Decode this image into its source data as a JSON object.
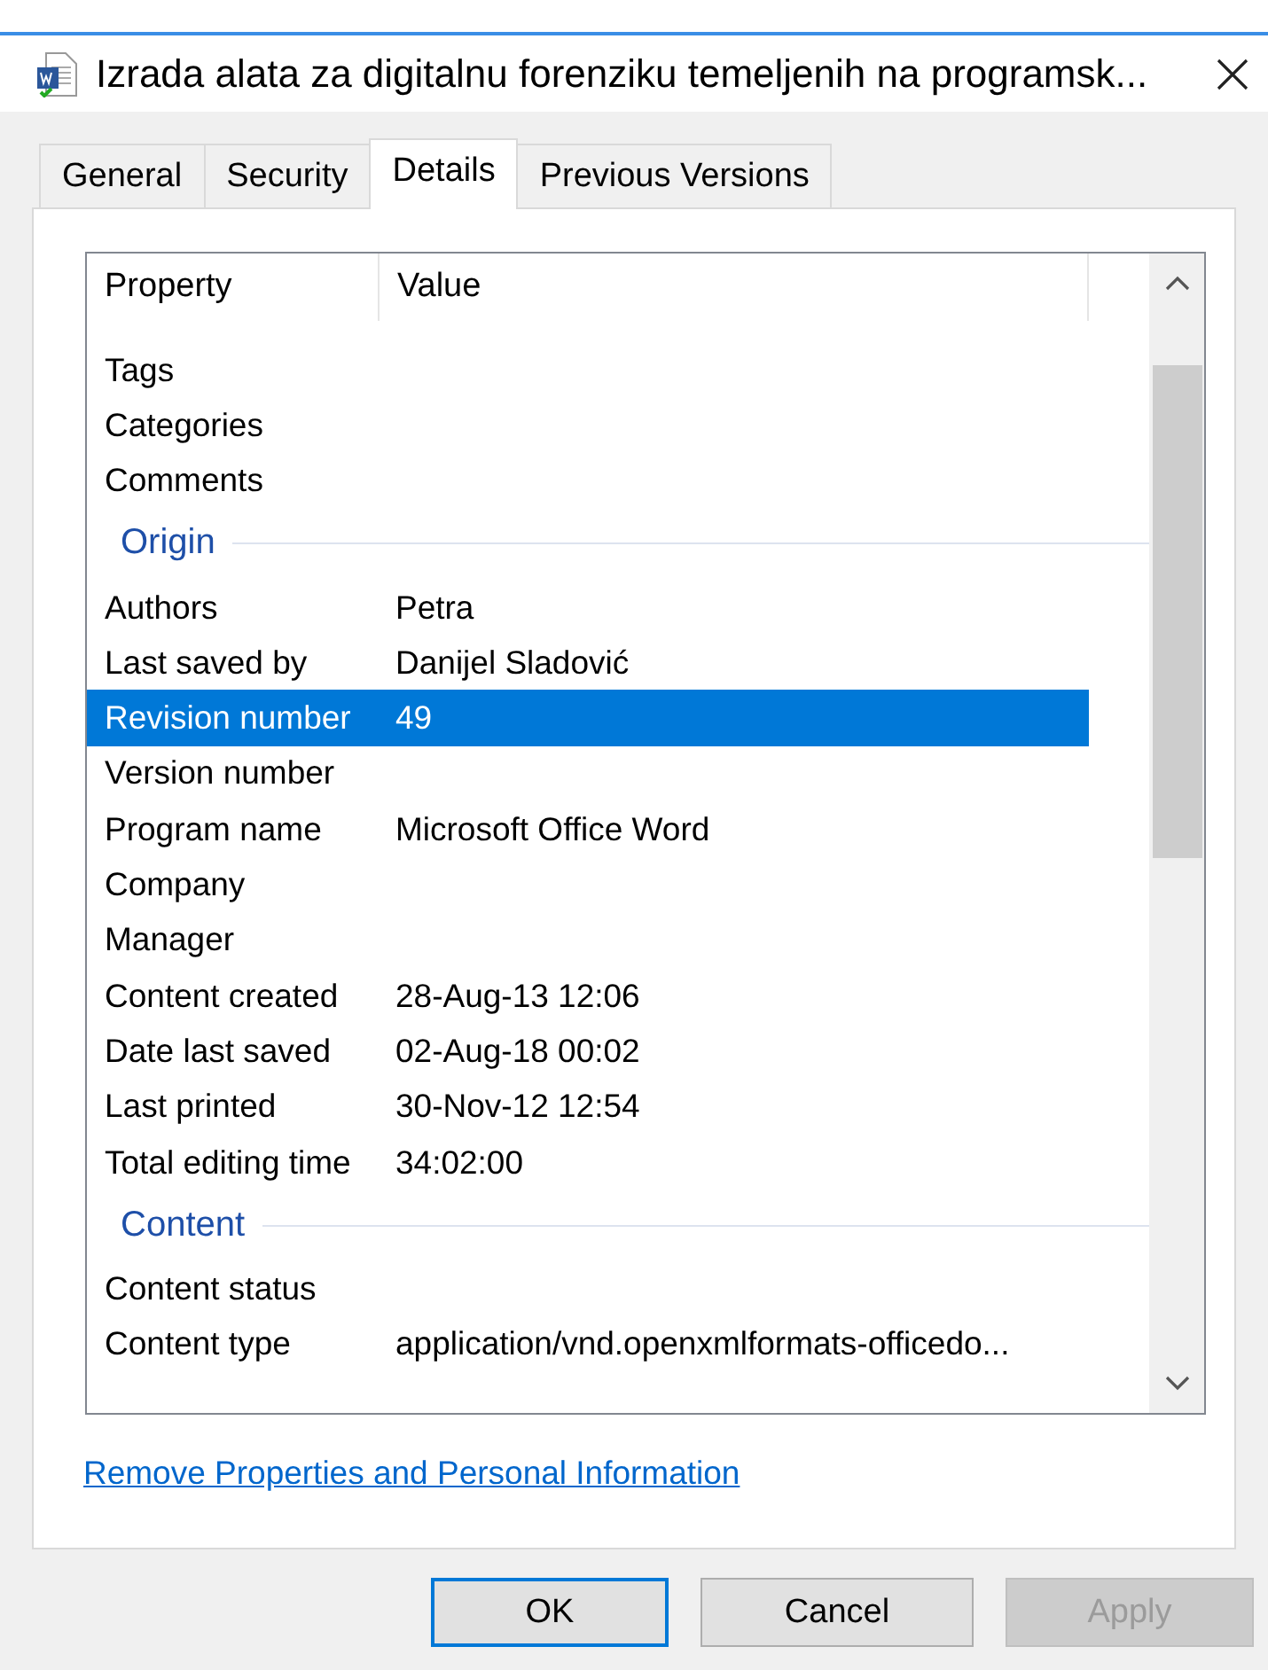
{
  "window": {
    "title": "Izrada alata za digitalnu forenziku temeljenih na programsk..."
  },
  "tabs": [
    {
      "label": "General",
      "selected": false
    },
    {
      "label": "Security",
      "selected": false
    },
    {
      "label": "Details",
      "selected": true
    },
    {
      "label": "Previous Versions",
      "selected": false
    }
  ],
  "table": {
    "columns": [
      "Property",
      "Value"
    ],
    "rows": [
      {
        "kind": "property",
        "property": "Tags",
        "value": "",
        "selected": false
      },
      {
        "kind": "property",
        "property": "Categories",
        "value": "",
        "selected": false
      },
      {
        "kind": "property",
        "property": "Comments",
        "value": "",
        "selected": false
      },
      {
        "kind": "group",
        "property": "Origin"
      },
      {
        "kind": "property",
        "property": "Authors",
        "value": "Petra",
        "selected": false
      },
      {
        "kind": "property",
        "property": "Last saved by",
        "value": "Danijel Sladović",
        "selected": false
      },
      {
        "kind": "property",
        "property": "Revision number",
        "value": "49",
        "selected": true
      },
      {
        "kind": "property",
        "property": "Version number",
        "value": "",
        "selected": false
      },
      {
        "kind": "property",
        "property": "Program name",
        "value": "Microsoft Office Word",
        "selected": false
      },
      {
        "kind": "property",
        "property": "Company",
        "value": "",
        "selected": false
      },
      {
        "kind": "property",
        "property": "Manager",
        "value": "",
        "selected": false
      },
      {
        "kind": "property",
        "property": "Content created",
        "value": "28-Aug-13 12:06",
        "selected": false
      },
      {
        "kind": "property",
        "property": "Date last saved",
        "value": "02-Aug-18 00:02",
        "selected": false
      },
      {
        "kind": "property",
        "property": "Last printed",
        "value": "30-Nov-12 12:54",
        "selected": false
      },
      {
        "kind": "property",
        "property": "Total editing time",
        "value": "34:02:00",
        "selected": false
      },
      {
        "kind": "group",
        "property": "Content"
      },
      {
        "kind": "property",
        "property": "Content status",
        "value": "",
        "selected": false
      },
      {
        "kind": "property",
        "property": "Content type",
        "value": "application/vnd.openxmlformats-officedo...",
        "selected": false
      }
    ]
  },
  "link": "Remove Properties and Personal Information",
  "buttons": [
    {
      "label": "OK",
      "disabled": false,
      "default": true
    },
    {
      "label": "Cancel",
      "disabled": false,
      "default": false
    },
    {
      "label": "Apply",
      "disabled": true,
      "default": false
    }
  ]
}
